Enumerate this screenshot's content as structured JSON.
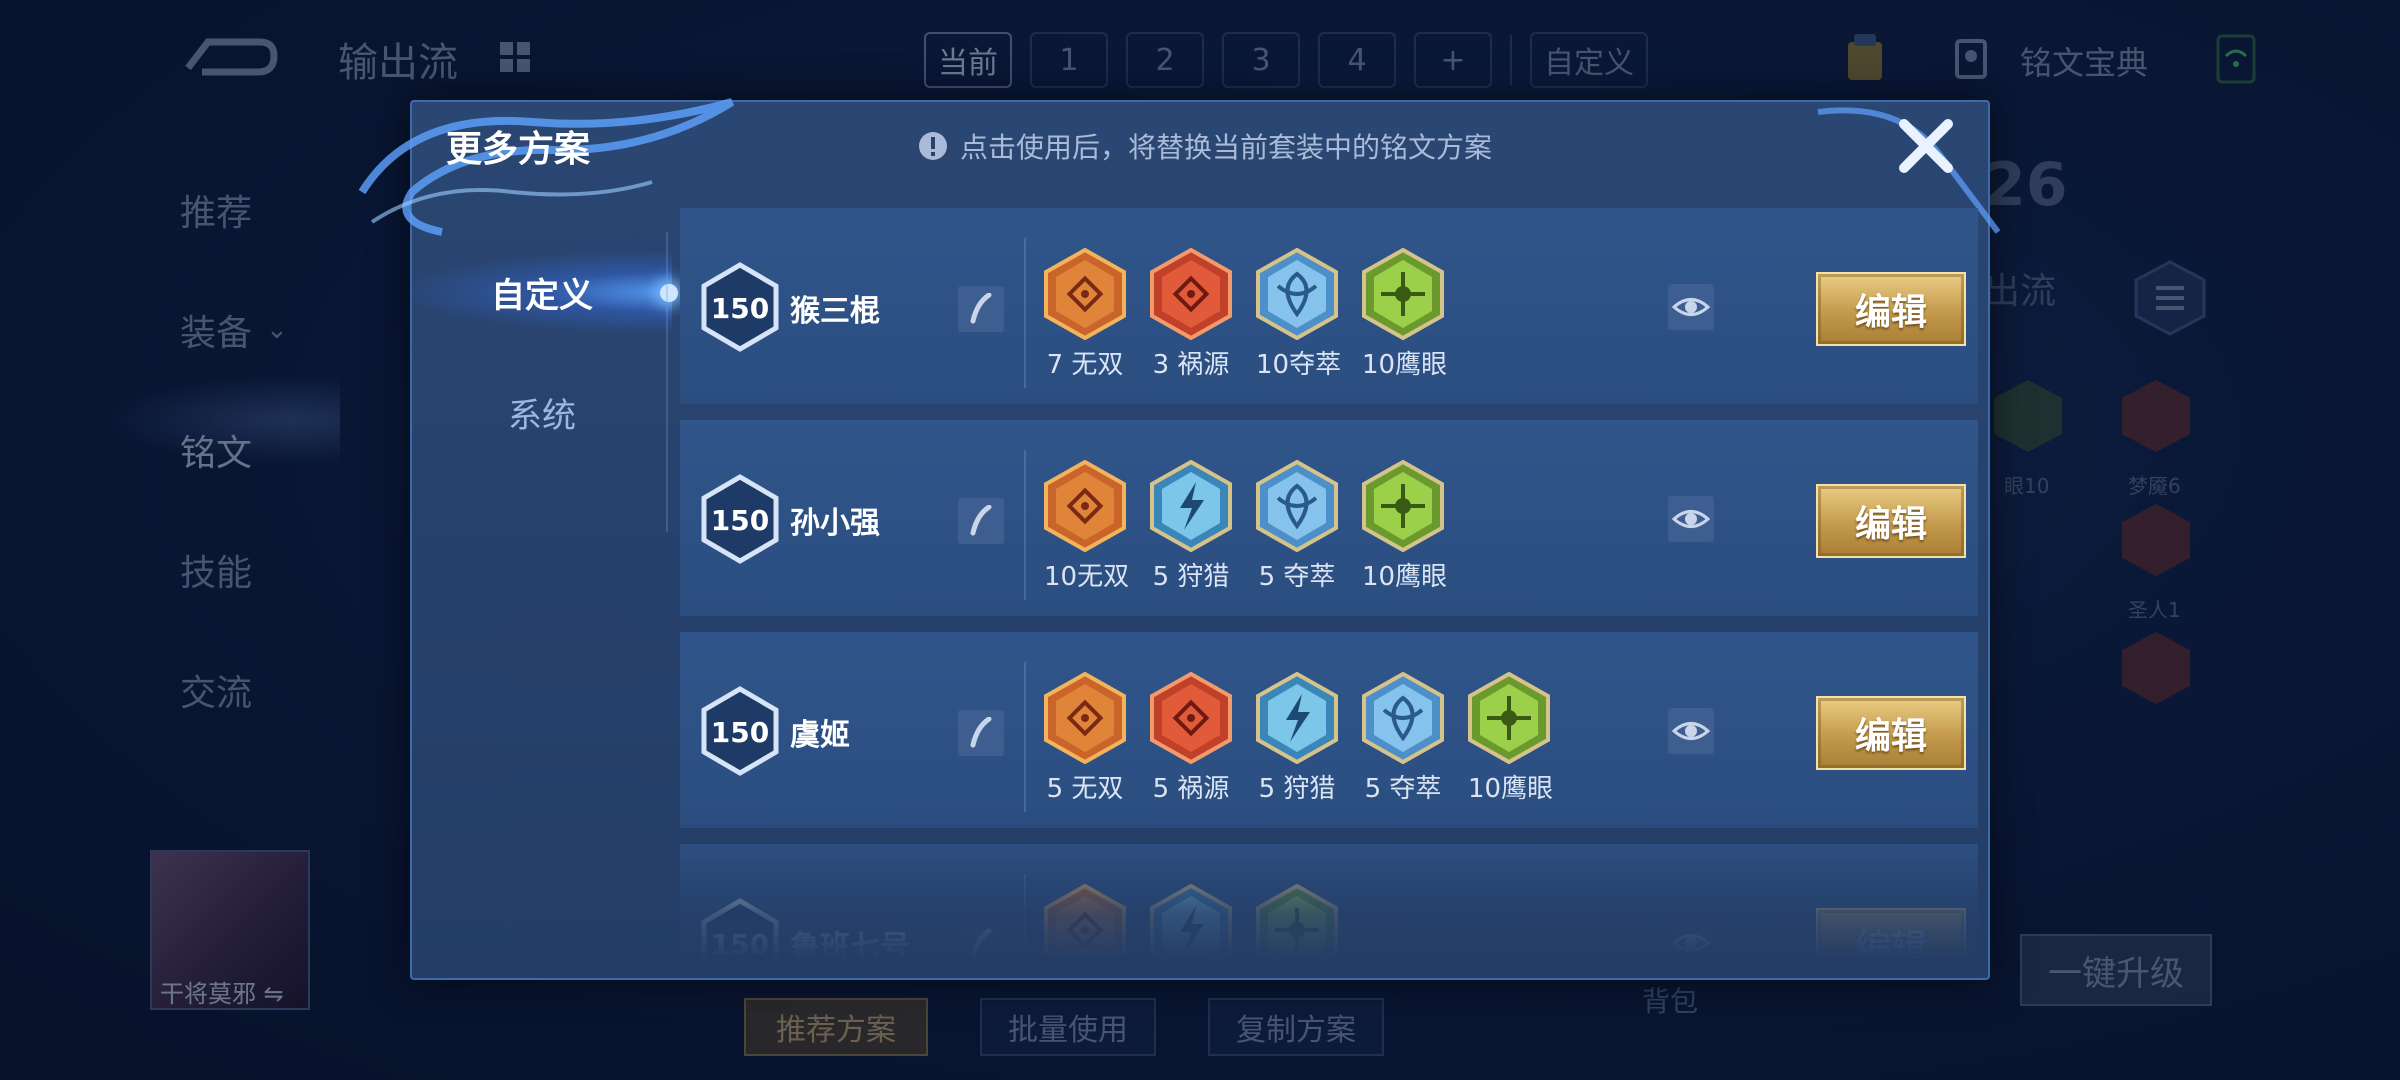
{
  "colors": {
    "accent_gold": "#d8b869",
    "modal_bg": "#264370",
    "row_bg": "#2e5285",
    "text_light": "#dbe4f5",
    "hint_text": "#a9bbd9"
  },
  "background": {
    "top_title": "输出流",
    "scheme_tabs": [
      "当前",
      "1",
      "2",
      "3",
      "4",
      "+",
      "自定义"
    ],
    "codex_label": "铭文宝典",
    "left_nav": [
      {
        "label": "推荐"
      },
      {
        "label": "装备"
      },
      {
        "label": "铭文"
      },
      {
        "label": "技能"
      },
      {
        "label": "交流"
      }
    ],
    "hero_name": "干将莫邪 ⇋",
    "bottom_buttons": [
      "推荐方案",
      "批量使用",
      "复制方案"
    ],
    "bag_label": "背包",
    "upgrade_button": "一键升级",
    "right_level": "26",
    "right_label": "出流",
    "bg_rune_labels": [
      "眼10",
      "梦魇6",
      "圣人1"
    ]
  },
  "modal": {
    "title": "更多方案",
    "hint": "点击使用后，将替换当前套装中的铭文方案",
    "side_tabs": [
      "自定义",
      "系统"
    ],
    "edit_label": "编辑",
    "rows": [
      {
        "level": "150",
        "name": "猴三棍",
        "runes": [
          {
            "type": "orange",
            "label": "7 无双"
          },
          {
            "type": "red",
            "label": "3 祸源"
          },
          {
            "type": "blue",
            "label": "10夺萃"
          },
          {
            "type": "green",
            "label": "10鹰眼"
          }
        ]
      },
      {
        "level": "150",
        "name": "孙小强",
        "runes": [
          {
            "type": "orange",
            "label": "10无双"
          },
          {
            "type": "lightning",
            "label": "5 狩猎"
          },
          {
            "type": "blue",
            "label": "5 夺萃"
          },
          {
            "type": "green",
            "label": "10鹰眼"
          }
        ]
      },
      {
        "level": "150",
        "name": "虞姬",
        "runes": [
          {
            "type": "orange",
            "label": "5 无双"
          },
          {
            "type": "red",
            "label": "5 祸源"
          },
          {
            "type": "lightning",
            "label": "5 狩猎"
          },
          {
            "type": "blue",
            "label": "5 夺萃"
          },
          {
            "type": "green",
            "label": "10鹰眼"
          }
        ]
      },
      {
        "level": "150",
        "name": "鲁班七号",
        "runes": [
          {
            "type": "orange",
            "label": ""
          },
          {
            "type": "lightning",
            "label": ""
          },
          {
            "type": "green",
            "label": ""
          }
        ]
      }
    ]
  }
}
